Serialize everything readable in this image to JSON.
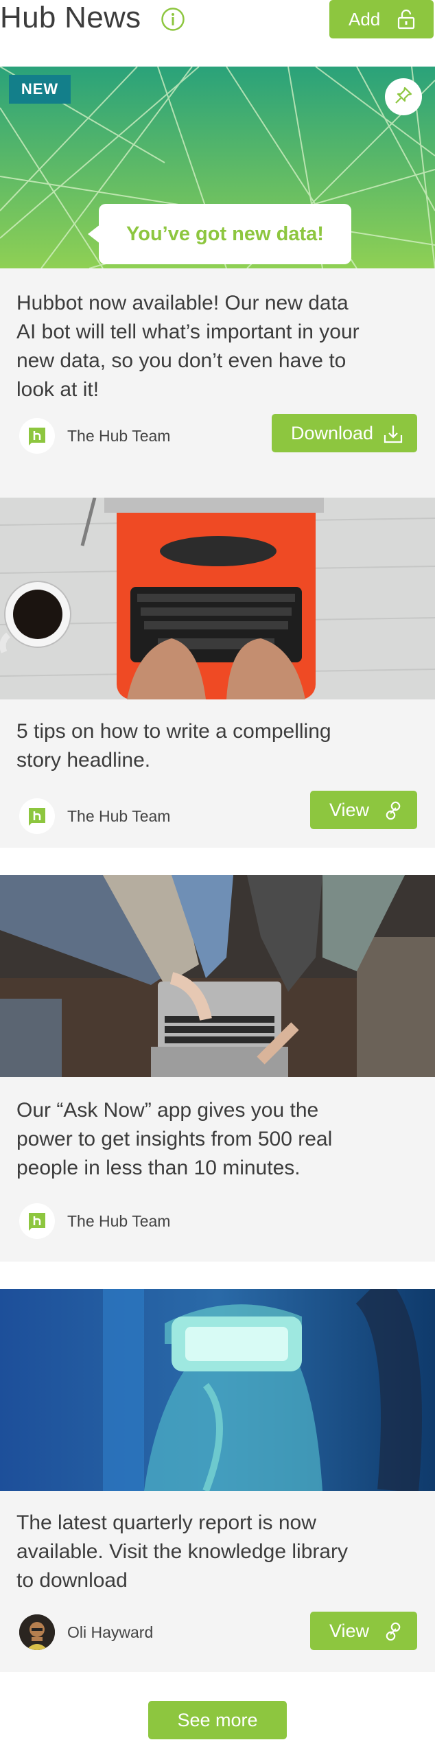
{
  "header": {
    "title": "Hub News",
    "add_label": "Add"
  },
  "cards": [
    {
      "badge": "NEW",
      "bubble": "You’ve got new data!",
      "text_lines": [
        "Hubbot now available! Our new data",
        "AI bot will tell what’s important in your",
        "new data, so you don’t even have to",
        "look at it!"
      ],
      "author": "The Hub Team",
      "action_label": "Download"
    },
    {
      "text_lines": [
        "5 tips on how to write a compelling",
        "story headline."
      ],
      "author": "The Hub Team",
      "action_label": "View"
    },
    {
      "text_lines": [
        "Our “Ask Now” app gives you the",
        "power to get insights from 500 real",
        "people in less than 10 minutes."
      ],
      "author": "The Hub Team"
    },
    {
      "text_lines": [
        "The latest quarterly report is now",
        "available. Visit the knowledge library",
        "to download"
      ],
      "author": "Oli Hayward",
      "action_label": "View"
    }
  ],
  "footer": {
    "see_more_label": "See more"
  },
  "colors": {
    "accent": "#8dc63f",
    "badge": "#137f8a",
    "card_bg": "#f4f4f4"
  },
  "icons": [
    "info-icon",
    "lock-icon",
    "pin-icon",
    "download-icon",
    "link-icon",
    "hub-logo-icon"
  ]
}
